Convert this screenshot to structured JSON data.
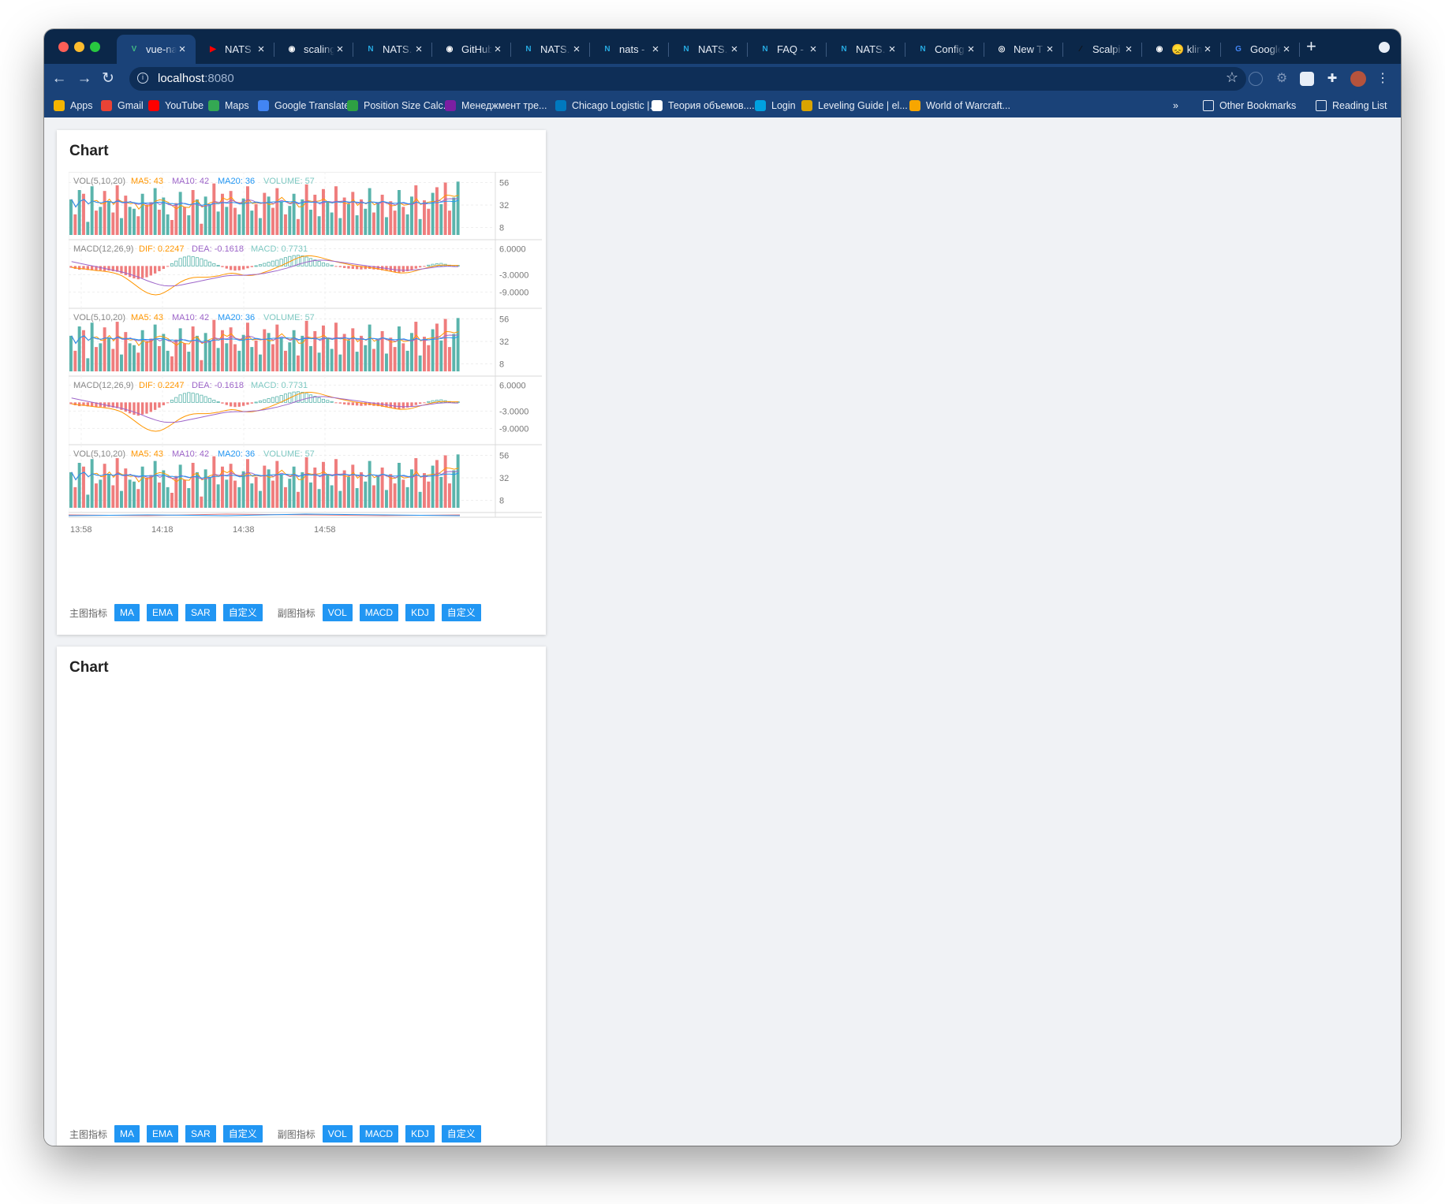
{
  "browser": {
    "tabs": [
      {
        "title": "vue-na",
        "icon": "vue-icon",
        "color": "#41b883",
        "glyph": "V",
        "active": true
      },
      {
        "title": "NATS",
        "icon": "youtube-icon",
        "color": "#ff0000",
        "glyph": "▶",
        "active": false
      },
      {
        "title": "scaling",
        "icon": "github-icon",
        "color": "#ffffff",
        "glyph": "◉",
        "active": false
      },
      {
        "title": "NATS.",
        "icon": "nats-icon",
        "color": "#27aae1",
        "glyph": "N",
        "active": false
      },
      {
        "title": "GitHub",
        "icon": "github-icon",
        "color": "#ffffff",
        "glyph": "◉",
        "active": false
      },
      {
        "title": "NATS.",
        "icon": "nats-icon",
        "color": "#27aae1",
        "glyph": "N",
        "active": false
      },
      {
        "title": "nats -",
        "icon": "nats-icon",
        "color": "#27aae1",
        "glyph": "N",
        "active": false
      },
      {
        "title": "NATS.",
        "icon": "nats-icon",
        "color": "#27aae1",
        "glyph": "N",
        "active": false
      },
      {
        "title": "FAQ -",
        "icon": "nats-icon",
        "color": "#27aae1",
        "glyph": "N",
        "active": false
      },
      {
        "title": "NATS.",
        "icon": "nats-icon",
        "color": "#27aae1",
        "glyph": "N",
        "active": false
      },
      {
        "title": "Config",
        "icon": "nats-icon",
        "color": "#27aae1",
        "glyph": "N",
        "active": false
      },
      {
        "title": "New T",
        "icon": "chrome-icon",
        "color": "#ffffff",
        "glyph": "◎",
        "active": false
      },
      {
        "title": "Scalpi",
        "icon": "pen-icon",
        "color": "#111111",
        "glyph": "⁄",
        "active": false
      },
      {
        "title": "😞 klin",
        "icon": "github-icon",
        "color": "#ffffff",
        "glyph": "◉",
        "active": false
      },
      {
        "title": "Google",
        "icon": "google-translate-icon",
        "color": "#4285f4",
        "glyph": "G",
        "active": false
      }
    ],
    "address": {
      "host": "localhost",
      "port": ":8080"
    },
    "bookmarks": [
      {
        "label": "Apps",
        "icon": "apps-grid-icon",
        "color": "#f4b400"
      },
      {
        "label": "Gmail",
        "icon": "gmail-icon",
        "color": "#ea4335"
      },
      {
        "label": "YouTube",
        "icon": "youtube-icon",
        "color": "#ff0000"
      },
      {
        "label": "Maps",
        "icon": "maps-icon",
        "color": "#34a853"
      },
      {
        "label": "Google Translate",
        "icon": "google-translate-icon",
        "color": "#4285f4"
      },
      {
        "label": "Position Size Calc...",
        "icon": "calculator-icon",
        "color": "#2ea043"
      },
      {
        "label": "Менеджмент тре...",
        "icon": "site-icon",
        "color": "#7b1fa2"
      },
      {
        "label": "Chicago Logistic |...",
        "icon": "trello-icon",
        "color": "#0079bf"
      },
      {
        "label": "Теория объемов....",
        "icon": "globe-icon",
        "color": "#ffffff"
      },
      {
        "label": "Login",
        "icon": "salesforce-cloud-icon",
        "color": "#00a1e0"
      },
      {
        "label": "Leveling Guide | el...",
        "icon": "game-icon",
        "color": "#d9a400"
      },
      {
        "label": "World of Warcraft...",
        "icon": "wow-icon",
        "color": "#f7a600"
      }
    ],
    "bookmarks_overflow": "»",
    "other_bookmarks": "Other Bookmarks",
    "reading_list": "Reading List"
  },
  "cards": [
    {
      "title": "Chart",
      "main_indicator_label": "主图指标",
      "main_indicators": [
        "MA",
        "EMA",
        "SAR",
        "自定义"
      ],
      "sub_indicator_label": "副图指标",
      "sub_indicators": [
        "VOL",
        "MACD",
        "KDJ",
        "自定义"
      ]
    },
    {
      "title": "Chart",
      "main_indicator_label": "主图指标",
      "main_indicators": [
        "MA",
        "EMA",
        "SAR",
        "自定义"
      ],
      "sub_indicator_label": "副图指标",
      "sub_indicators": [
        "VOL",
        "MACD",
        "KDJ",
        "自定义"
      ]
    }
  ],
  "chart_data": {
    "type": "bar",
    "colors": {
      "up": "#5ab4ac",
      "down": "#ef7d7d",
      "ma5": "#ff9600",
      "ma10": "#9d65c9",
      "ma20": "#2196f3",
      "dif": "#ff9600",
      "dea": "#9d65c9",
      "axis_text": "#777777"
    },
    "x_tick_labels": [
      "13:58",
      "14:18",
      "14:38",
      "14:58"
    ],
    "panes": [
      {
        "kind": "vol",
        "legend": [
          "VOL(5,10,20)",
          "MA5: 43",
          "MA10: 42",
          "MA20: 36",
          "VOLUME: 57"
        ],
        "y_ticks": [
          "56",
          "32",
          "8"
        ],
        "ylim": [
          0,
          64
        ]
      },
      {
        "kind": "macd",
        "legend": [
          "MACD(12,26,9)",
          "DIF: 0.2247",
          "DEA: -0.1618",
          "MACD: 0.7731"
        ],
        "y_ticks": [
          "6.0000",
          "-3.0000",
          "-9.0000"
        ],
        "ylim": [
          -13,
          8
        ]
      },
      {
        "kind": "vol",
        "legend": [
          "VOL(5,10,20)",
          "MA5: 43",
          "MA10: 42",
          "MA20: 36",
          "VOLUME: 57"
        ],
        "y_ticks": [
          "56",
          "32",
          "8"
        ],
        "ylim": [
          0,
          64
        ]
      },
      {
        "kind": "macd",
        "legend": [
          "MACD(12,26,9)",
          "DIF: 0.2247",
          "DEA: -0.1618",
          "MACD: 0.7731"
        ],
        "y_ticks": [
          "6.0000",
          "-3.0000",
          "-9.0000"
        ],
        "ylim": [
          -13,
          8
        ]
      },
      {
        "kind": "vol",
        "legend": [
          "VOL(5,10,20)",
          "MA5: 43",
          "MA10: 42",
          "MA20: 36",
          "VOLUME: 57"
        ],
        "y_ticks": [
          "56",
          "32",
          "8"
        ],
        "ylim": [
          0,
          64
        ]
      }
    ],
    "volume": [
      38,
      22,
      48,
      44,
      14,
      52,
      26,
      30,
      47,
      36,
      24,
      53,
      18,
      42,
      30,
      28,
      20,
      44,
      32,
      35,
      50,
      27,
      40,
      22,
      16,
      34,
      46,
      30,
      21,
      48,
      38,
      12,
      41,
      33,
      55,
      25,
      44,
      30,
      47,
      29,
      22,
      39,
      52,
      26,
      33,
      18,
      45,
      41,
      29,
      50,
      36,
      22,
      31,
      44,
      17,
      38,
      54,
      27,
      43,
      20,
      49,
      35,
      24,
      52,
      18,
      40,
      33,
      46,
      21,
      38,
      28,
      50,
      24,
      34,
      43,
      19,
      36,
      26,
      48,
      30,
      22,
      41,
      53,
      17,
      37,
      28,
      45,
      51,
      33,
      56,
      26,
      40,
      57
    ],
    "volume_up": [
      1,
      0,
      1,
      0,
      1,
      1,
      0,
      1,
      0,
      1,
      0,
      0,
      1,
      0,
      1,
      1,
      0,
      1,
      0,
      0,
      1,
      0,
      1,
      1,
      0,
      0,
      1,
      0,
      1,
      0,
      1,
      0,
      1,
      1,
      0,
      1,
      0,
      1,
      0,
      0,
      1,
      1,
      0,
      1,
      0,
      1,
      0,
      1,
      0,
      0,
      1,
      0,
      1,
      1,
      0,
      1,
      0,
      1,
      0,
      1,
      0,
      1,
      1,
      0,
      1,
      0,
      1,
      0,
      1,
      0,
      1,
      1,
      0,
      1,
      0,
      1,
      0,
      0,
      1,
      0,
      1,
      1,
      0,
      1,
      0,
      0,
      1,
      0,
      1,
      0,
      0,
      1,
      1
    ],
    "macd_hist": [
      -0.6,
      -1.0,
      -1.3,
      -1.2,
      -1.4,
      -1.5,
      -1.6,
      -1.5,
      -1.7,
      -1.6,
      -1.8,
      -2.0,
      -2.6,
      -3.2,
      -3.8,
      -4.3,
      -4.6,
      -4.2,
      -3.9,
      -3.3,
      -2.6,
      -1.8,
      -1.0,
      -0.2,
      0.8,
      1.7,
      2.6,
      3.1,
      3.4,
      3.2,
      2.9,
      2.5,
      2.0,
      1.4,
      0.8,
      0.2,
      -0.4,
      -0.9,
      -1.4,
      -1.6,
      -1.5,
      -1.2,
      -0.8,
      -0.4,
      0.1,
      0.5,
      0.9,
      1.3,
      1.7,
      2.0,
      2.4,
      2.9,
      3.3,
      3.6,
      3.7,
      3.5,
      3.1,
      2.6,
      2.1,
      1.6,
      1.1,
      0.7,
      0.3,
      -0.1,
      -0.4,
      -0.7,
      -0.9,
      -1.0,
      -1.1,
      -1.2,
      -1.1,
      -1.0,
      -1.2,
      -1.3,
      -1.5,
      -1.7,
      -1.9,
      -2.1,
      -2.3,
      -2.1,
      -1.8,
      -1.4,
      -0.9,
      -0.5,
      -0.1,
      0.3,
      0.6,
      0.8,
      0.9,
      0.6,
      0.3,
      0.1,
      0.2
    ],
    "macd_dif": [
      -0.5,
      -0.7,
      -0.9,
      -1.0,
      -1.2,
      -1.4,
      -1.6,
      -1.7,
      -1.9,
      -2.1,
      -2.4,
      -2.8,
      -3.4,
      -4.3,
      -5.3,
      -6.4,
      -7.5,
      -8.5,
      -9.3,
      -9.8,
      -10.0,
      -9.8,
      -9.2,
      -8.4,
      -7.4,
      -6.4,
      -5.5,
      -4.8,
      -4.3,
      -4.0,
      -3.9,
      -3.9,
      -3.9,
      -3.8,
      -3.6,
      -3.4,
      -3.0,
      -2.7,
      -2.5,
      -2.6,
      -2.9,
      -3.2,
      -3.3,
      -3.2,
      -3.0,
      -2.6,
      -2.1,
      -1.6,
      -1.0,
      -0.4,
      0.2,
      0.9,
      1.6,
      2.3,
      2.9,
      3.3,
      3.5,
      3.5,
      3.3,
      3.0,
      2.6,
      2.2,
      1.8,
      1.4,
      1.1,
      0.8,
      0.5,
      0.2,
      0.0,
      -0.2,
      -0.4,
      -0.6,
      -0.8,
      -1.0,
      -1.3,
      -1.6,
      -1.9,
      -2.2,
      -2.4,
      -2.4,
      -2.3,
      -2.0,
      -1.6,
      -1.2,
      -0.8,
      -0.4,
      -0.1,
      0.2,
      0.3,
      0.3,
      0.2,
      0.2,
      0.2
    ],
    "macd_dea": [
      1.5,
      1.2,
      0.9,
      0.6,
      0.3,
      0.0,
      -0.3,
      -0.6,
      -0.9,
      -1.2,
      -1.5,
      -1.8,
      -2.1,
      -2.5,
      -2.9,
      -3.4,
      -3.9,
      -4.5,
      -5.1,
      -5.6,
      -6.1,
      -6.5,
      -6.8,
      -6.9,
      -6.9,
      -6.8,
      -6.6,
      -6.3,
      -6.0,
      -5.7,
      -5.4,
      -5.1,
      -4.8,
      -4.5,
      -4.2,
      -3.9,
      -3.6,
      -3.4,
      -3.3,
      -3.2,
      -3.2,
      -3.2,
      -3.1,
      -3.0,
      -2.9,
      -2.7,
      -2.5,
      -2.2,
      -1.9,
      -1.6,
      -1.2,
      -0.8,
      -0.4,
      0.1,
      0.6,
      1.0,
      1.4,
      1.7,
      1.9,
      2.0,
      2.0,
      1.9,
      1.7,
      1.5,
      1.3,
      1.1,
      0.9,
      0.7,
      0.5,
      0.3,
      0.1,
      -0.1,
      -0.3,
      -0.5,
      -0.7,
      -0.9,
      -1.1,
      -1.3,
      -1.4,
      -1.5,
      -1.5,
      -1.4,
      -1.3,
      -1.1,
      -0.9,
      -0.7,
      -0.5,
      -0.3,
      -0.2,
      -0.1,
      -0.1,
      -0.2,
      -0.2
    ]
  }
}
